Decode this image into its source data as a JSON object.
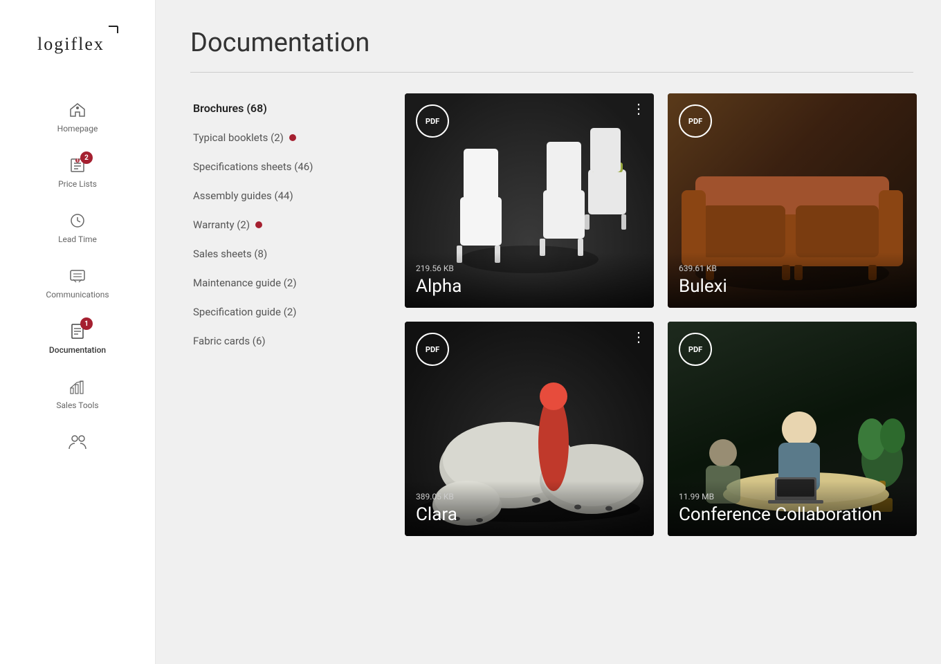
{
  "app": {
    "name": "Logiflex"
  },
  "sidebar": {
    "items": [
      {
        "id": "homepage",
        "label": "Homepage",
        "icon": "home-icon",
        "badge": null
      },
      {
        "id": "price-lists",
        "label": "Price Lists",
        "icon": "price-list-icon",
        "badge": 2
      },
      {
        "id": "lead-time",
        "label": "Lead Time",
        "icon": "clock-icon",
        "badge": null
      },
      {
        "id": "communications",
        "label": "Communications",
        "icon": "comm-icon",
        "badge": null
      },
      {
        "id": "documentation",
        "label": "Documentation",
        "icon": "doc-icon",
        "badge": 1,
        "active": true
      },
      {
        "id": "sales-tools",
        "label": "Sales Tools",
        "icon": "sales-icon",
        "badge": null
      },
      {
        "id": "users",
        "label": "Users",
        "icon": "users-icon",
        "badge": null
      }
    ]
  },
  "page": {
    "title": "Documentation"
  },
  "filters": [
    {
      "id": "brochures",
      "label": "Brochures (68)",
      "active": true,
      "dot": false
    },
    {
      "id": "typical-booklets",
      "label": "Typical booklets (2)",
      "active": false,
      "dot": true
    },
    {
      "id": "spec-sheets",
      "label": "Specifications sheets (46)",
      "active": false,
      "dot": false
    },
    {
      "id": "assembly-guides",
      "label": "Assembly guides (44)",
      "active": false,
      "dot": false
    },
    {
      "id": "warranty",
      "label": "Warranty (2)",
      "active": false,
      "dot": true
    },
    {
      "id": "sales-sheets",
      "label": "Sales sheets (8)",
      "active": false,
      "dot": false
    },
    {
      "id": "maintenance-guide",
      "label": "Maintenance guide (2)",
      "active": false,
      "dot": false
    },
    {
      "id": "spec-guide",
      "label": "Specification guide (2)",
      "active": false,
      "dot": false
    },
    {
      "id": "fabric-cards",
      "label": "Fabric cards (6)",
      "active": false,
      "dot": false
    }
  ],
  "cards": [
    {
      "id": "alpha",
      "name": "Alpha",
      "filesize": "219.56 KB",
      "type": "PDF",
      "theme": "alpha"
    },
    {
      "id": "bulexi",
      "name": "Bulexi",
      "filesize": "639.61 KB",
      "type": "PDF",
      "theme": "bulexi"
    },
    {
      "id": "clara",
      "name": "Clara",
      "filesize": "389.05 KB",
      "type": "PDF",
      "theme": "clara"
    },
    {
      "id": "conference",
      "name": "Conference Collaboration",
      "filesize": "11.99 MB",
      "type": "PDF",
      "theme": "conference"
    }
  ],
  "icons": {
    "home": "⌂",
    "dollar": "$",
    "clock": "⏱",
    "comm": "▤",
    "doc": "📄",
    "sales": "📊",
    "users": "👥",
    "pdf": "PDF",
    "menu": "⋮"
  }
}
